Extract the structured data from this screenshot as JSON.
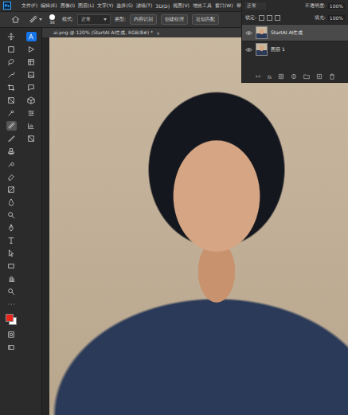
{
  "app": {
    "logo": "Ps"
  },
  "menu": [
    "文件(F)",
    "编辑(E)",
    "图像(I)",
    "图层(L)",
    "文字(Y)",
    "选择(S)",
    "滤镜(T)",
    "3D(D)",
    "视图(V)",
    "增效工具",
    "窗口(W)",
    "帮助(H)"
  ],
  "options": {
    "brush_size": "38",
    "mode_label": "模式:",
    "mode": "正常",
    "type_label": "类型:",
    "types": [
      {
        "label": "内容识别",
        "selected": false
      },
      {
        "label": "创建纹理",
        "selected": false
      },
      {
        "label": "近似匹配",
        "selected": false
      }
    ]
  },
  "document_tab": {
    "title": "ai.png @ 120% (StartAI AI生成, RGB/8#) *",
    "close": "×"
  },
  "tools": [
    {
      "kind": "move",
      "selected": false
    },
    {
      "kind": "marquee",
      "selected": false
    },
    {
      "kind": "lasso",
      "selected": false
    },
    {
      "kind": "select",
      "selected": false
    },
    {
      "kind": "crop",
      "selected": false
    },
    {
      "kind": "frame",
      "selected": false
    },
    {
      "kind": "eyedropper",
      "selected": false
    },
    {
      "kind": "heal",
      "selected": true
    },
    {
      "kind": "brush",
      "selected": false
    },
    {
      "kind": "stamp",
      "selected": false
    },
    {
      "kind": "history",
      "selected": false
    },
    {
      "kind": "eraser",
      "selected": false
    },
    {
      "kind": "gradient",
      "selected": false
    },
    {
      "kind": "blur",
      "selected": false
    },
    {
      "kind": "dodge",
      "selected": false
    },
    {
      "kind": "pen",
      "selected": false
    },
    {
      "kind": "type",
      "selected": false
    },
    {
      "kind": "path",
      "selected": false
    },
    {
      "kind": "shape",
      "selected": false
    },
    {
      "kind": "hand",
      "selected": false
    },
    {
      "kind": "zoom",
      "selected": false
    },
    {
      "kind": "more",
      "selected": false
    }
  ],
  "plugins": [
    {
      "kind": "startai",
      "selected": true
    },
    {
      "kind": "play",
      "selected": false
    },
    {
      "kind": "table",
      "selected": false
    },
    {
      "kind": "image",
      "selected": false
    },
    {
      "kind": "comment",
      "selected": false
    },
    {
      "kind": "cube",
      "selected": false
    },
    {
      "kind": "sliders",
      "selected": false
    },
    {
      "kind": "chart",
      "selected": false
    },
    {
      "kind": "frame",
      "selected": false
    }
  ],
  "colors": {
    "foreground": "#e8261c",
    "background": "#ffffff"
  },
  "layers": {
    "blend_mode": "正常",
    "opacity_label": "不透明度:",
    "opacity": "100%",
    "lock_label": "锁定:",
    "fill_label": "填充:",
    "fill": "100%",
    "items": [
      {
        "name": "StartAI AI生成",
        "selected": true,
        "visible": true
      },
      {
        "name": "图层 1",
        "selected": false,
        "visible": true
      }
    ],
    "footer_fx": "fx"
  }
}
